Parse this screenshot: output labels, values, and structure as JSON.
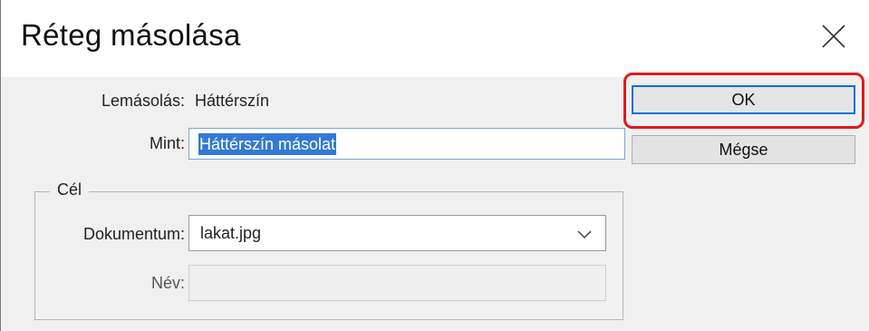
{
  "window": {
    "title": "Réteg másolása",
    "close_icon": "close-icon"
  },
  "form": {
    "duplicate_label": "Lemásolás:",
    "duplicate_value": "Háttérszín",
    "as_label": "Mint:",
    "as_value": "Háttérszín másolat"
  },
  "destination": {
    "legend": "Cél",
    "document_label": "Dokumentum:",
    "document_value": "lakat.jpg",
    "name_label": "Név:",
    "name_value": ""
  },
  "buttons": {
    "ok_label": "OK",
    "cancel_label": "Mégse"
  },
  "colors": {
    "accent": "#0a6fd6",
    "selection": "#3379d4",
    "highlight_annotation": "#e01a1a"
  }
}
